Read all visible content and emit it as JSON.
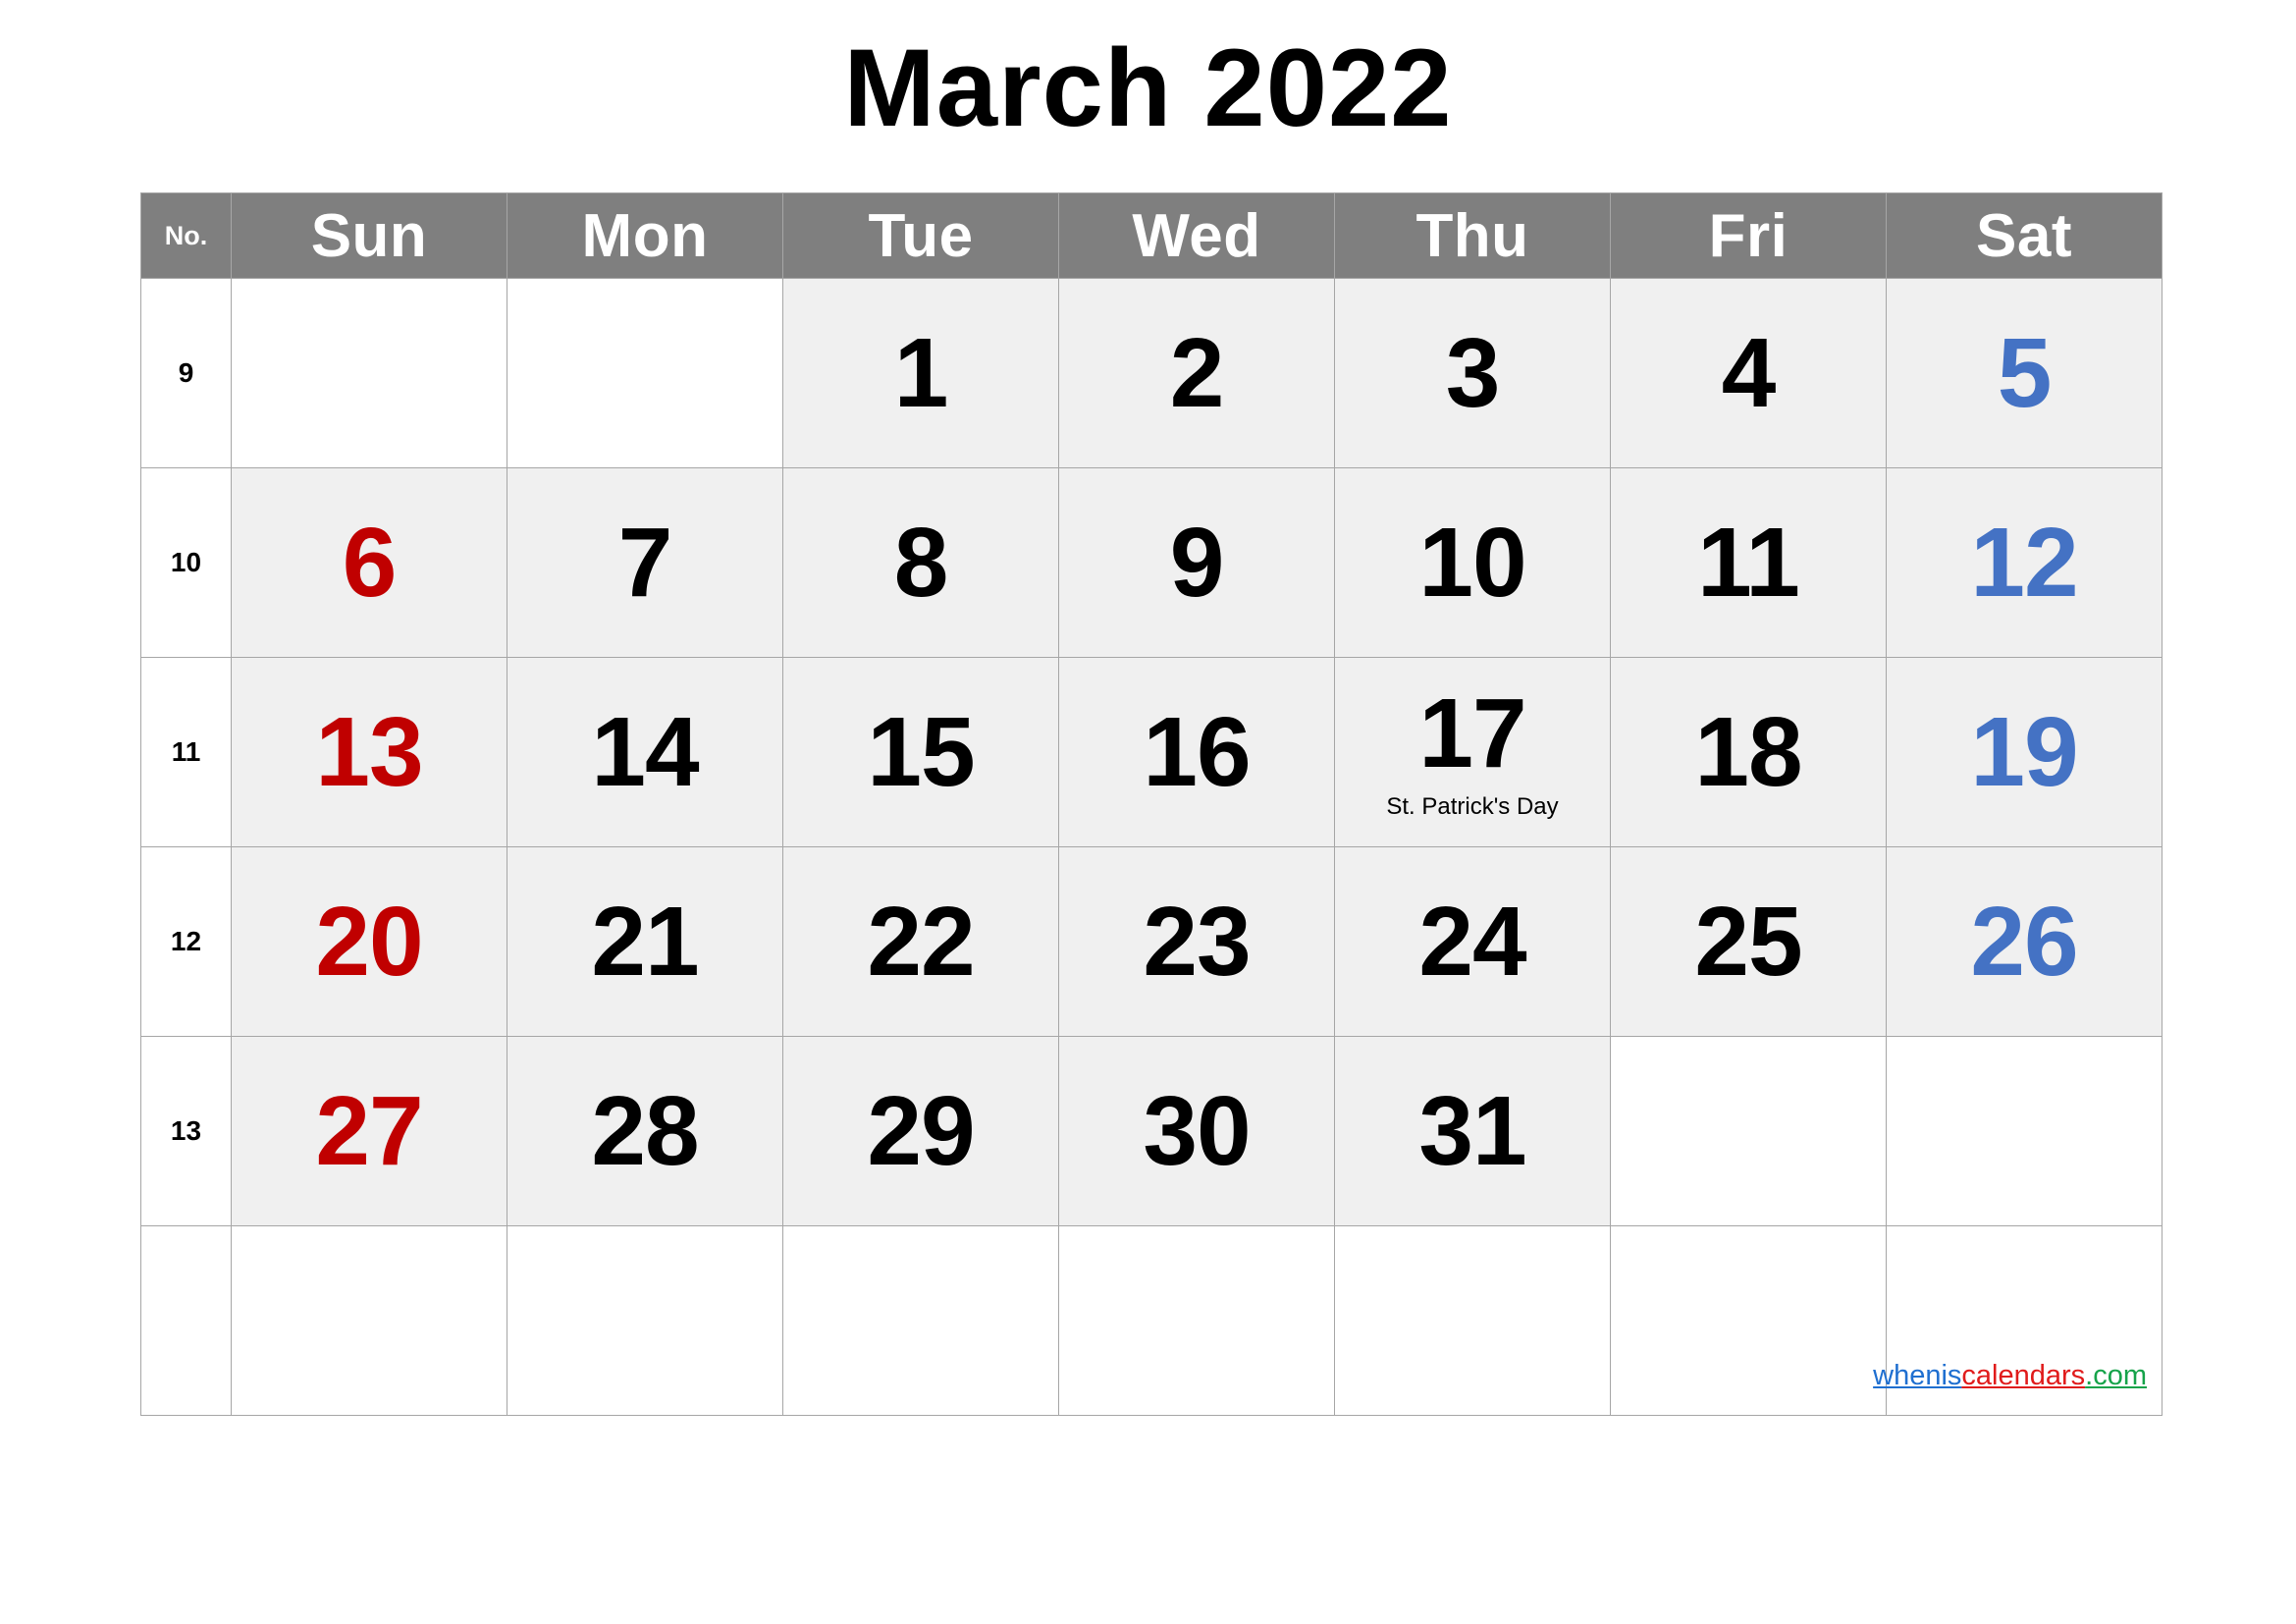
{
  "title": "March 2022",
  "colors": {
    "header_bg": "#7f7f7f",
    "header_text": "#ffffff",
    "cell_filled_bg": "#f0f0f0",
    "cell_empty_bg": "#ffffff",
    "sunday": "#c00000",
    "saturday": "#4472c4",
    "weekday": "#000000",
    "border": "#a6a6a6"
  },
  "header": {
    "week_no_label": "No.",
    "days": [
      "Sun",
      "Mon",
      "Tue",
      "Wed",
      "Thu",
      "Fri",
      "Sat"
    ]
  },
  "weeks": [
    {
      "no": "9",
      "days": [
        {
          "date": "",
          "event": "",
          "filled": false,
          "kind": "sun"
        },
        {
          "date": "",
          "event": "",
          "filled": false,
          "kind": "wd"
        },
        {
          "date": "1",
          "event": "",
          "filled": true,
          "kind": "wd"
        },
        {
          "date": "2",
          "event": "",
          "filled": true,
          "kind": "wd"
        },
        {
          "date": "3",
          "event": "",
          "filled": true,
          "kind": "wd"
        },
        {
          "date": "4",
          "event": "",
          "filled": true,
          "kind": "wd"
        },
        {
          "date": "5",
          "event": "",
          "filled": true,
          "kind": "sat"
        }
      ]
    },
    {
      "no": "10",
      "days": [
        {
          "date": "6",
          "event": "",
          "filled": true,
          "kind": "sun"
        },
        {
          "date": "7",
          "event": "",
          "filled": true,
          "kind": "wd"
        },
        {
          "date": "8",
          "event": "",
          "filled": true,
          "kind": "wd"
        },
        {
          "date": "9",
          "event": "",
          "filled": true,
          "kind": "wd"
        },
        {
          "date": "10",
          "event": "",
          "filled": true,
          "kind": "wd"
        },
        {
          "date": "11",
          "event": "",
          "filled": true,
          "kind": "wd"
        },
        {
          "date": "12",
          "event": "",
          "filled": true,
          "kind": "sat"
        }
      ]
    },
    {
      "no": "11",
      "days": [
        {
          "date": "13",
          "event": "",
          "filled": true,
          "kind": "sun"
        },
        {
          "date": "14",
          "event": "",
          "filled": true,
          "kind": "wd"
        },
        {
          "date": "15",
          "event": "",
          "filled": true,
          "kind": "wd"
        },
        {
          "date": "16",
          "event": "",
          "filled": true,
          "kind": "wd"
        },
        {
          "date": "17",
          "event": "St. Patrick's Day",
          "filled": true,
          "kind": "wd"
        },
        {
          "date": "18",
          "event": "",
          "filled": true,
          "kind": "wd"
        },
        {
          "date": "19",
          "event": "",
          "filled": true,
          "kind": "sat"
        }
      ]
    },
    {
      "no": "12",
      "days": [
        {
          "date": "20",
          "event": "",
          "filled": true,
          "kind": "sun"
        },
        {
          "date": "21",
          "event": "",
          "filled": true,
          "kind": "wd"
        },
        {
          "date": "22",
          "event": "",
          "filled": true,
          "kind": "wd"
        },
        {
          "date": "23",
          "event": "",
          "filled": true,
          "kind": "wd"
        },
        {
          "date": "24",
          "event": "",
          "filled": true,
          "kind": "wd"
        },
        {
          "date": "25",
          "event": "",
          "filled": true,
          "kind": "wd"
        },
        {
          "date": "26",
          "event": "",
          "filled": true,
          "kind": "sat"
        }
      ]
    },
    {
      "no": "13",
      "days": [
        {
          "date": "27",
          "event": "",
          "filled": true,
          "kind": "sun"
        },
        {
          "date": "28",
          "event": "",
          "filled": true,
          "kind": "wd"
        },
        {
          "date": "29",
          "event": "",
          "filled": true,
          "kind": "wd"
        },
        {
          "date": "30",
          "event": "",
          "filled": true,
          "kind": "wd"
        },
        {
          "date": "31",
          "event": "",
          "filled": true,
          "kind": "wd"
        },
        {
          "date": "",
          "event": "",
          "filled": false,
          "kind": "wd"
        },
        {
          "date": "",
          "event": "",
          "filled": false,
          "kind": "sat"
        }
      ]
    },
    {
      "no": "",
      "days": [
        {
          "date": "",
          "event": "",
          "filled": false,
          "kind": "sun"
        },
        {
          "date": "",
          "event": "",
          "filled": false,
          "kind": "wd"
        },
        {
          "date": "",
          "event": "",
          "filled": false,
          "kind": "wd"
        },
        {
          "date": "",
          "event": "",
          "filled": false,
          "kind": "wd"
        },
        {
          "date": "",
          "event": "",
          "filled": false,
          "kind": "wd"
        },
        {
          "date": "",
          "event": "",
          "filled": false,
          "kind": "wd"
        },
        {
          "date": "",
          "event": "",
          "filled": false,
          "kind": "sat"
        }
      ]
    }
  ],
  "watermark": {
    "part1": "whenis",
    "part2": "calendars",
    "part3": ".com"
  }
}
